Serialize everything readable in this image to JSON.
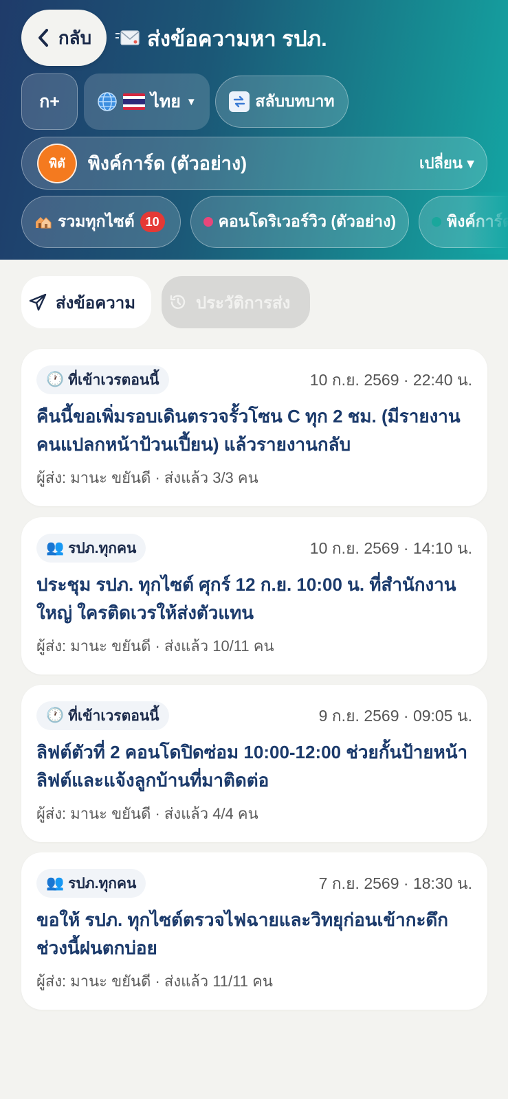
{
  "header": {
    "back_label": "กลับ",
    "title": "ส่งข้อความหา รปภ.",
    "font_button": "ก+",
    "language_label": "ไทย",
    "language_flag": "🇹🇭",
    "switch_role_label": "สลับบทบาท",
    "company": {
      "avatar_text": "พิตั",
      "name": "พิงค์การ์ด (ตัวอย่าง)",
      "change_label": "เปลี่ยน ▾"
    },
    "sites": [
      {
        "label": "รวมทุกไซต์",
        "badge": "10"
      },
      {
        "label": "คอนโดริเวอร์วิว (ตัวอย่าง)",
        "dot_color": "#e8477a"
      },
      {
        "label": "พิงค์การ์ด",
        "dot_color": "#1aa79c"
      }
    ]
  },
  "tabs": {
    "send": "ส่งข้อความ",
    "history": "ประวัติการส่ง"
  },
  "messages": [
    {
      "tag_icon": "clock",
      "tag": "ที่เข้าเวรตอนนี้",
      "time": "10 ก.ย. 2569 · 22:40 น.",
      "body": "คืนนี้ขอเพิ่มรอบเดินตรวจรั้วโซน C ทุก 2 ชม. (มีรายงานคนแปลกหน้าป้วนเปี้ยน) แล้วรายงานกลับ",
      "meta": "ผู้ส่ง: มานะ ขยันดี · ส่งแล้ว 3/3 คน"
    },
    {
      "tag_icon": "people",
      "tag": "รปภ.ทุกคน",
      "time": "10 ก.ย. 2569 · 14:10 น.",
      "body": "ประชุม รปภ. ทุกไซต์ ศุกร์ 12 ก.ย. 10:00 น. ที่สำนักงานใหญ่ ใครติดเวรให้ส่งตัวแทน",
      "meta": "ผู้ส่ง: มานะ ขยันดี · ส่งแล้ว 10/11 คน"
    },
    {
      "tag_icon": "clock",
      "tag": "ที่เข้าเวรตอนนี้",
      "time": "9 ก.ย. 2569 · 09:05 น.",
      "body": "ลิฟต์ตัวที่ 2 คอนโดปิดซ่อม 10:00-12:00 ช่วยกั้นป้ายหน้าลิฟต์และแจ้งลูกบ้านที่มาติดต่อ",
      "meta": "ผู้ส่ง: มานะ ขยันดี · ส่งแล้ว 4/4 คน"
    },
    {
      "tag_icon": "people",
      "tag": "รปภ.ทุกคน",
      "time": "7 ก.ย. 2569 · 18:30 น.",
      "body": "ขอให้ รปภ. ทุกไซต์ตรวจไฟฉายและวิทยุก่อนเข้ากะดึก ช่วงนี้ฝนตกบ่อย",
      "meta": "ผู้ส่ง: มานะ ขยันดี · ส่งแล้ว 11/11 คน"
    }
  ],
  "colors": {
    "accent_dark": "#1b3a6b",
    "badge_red": "#e53935",
    "avatar_orange": "#f47a1f"
  }
}
